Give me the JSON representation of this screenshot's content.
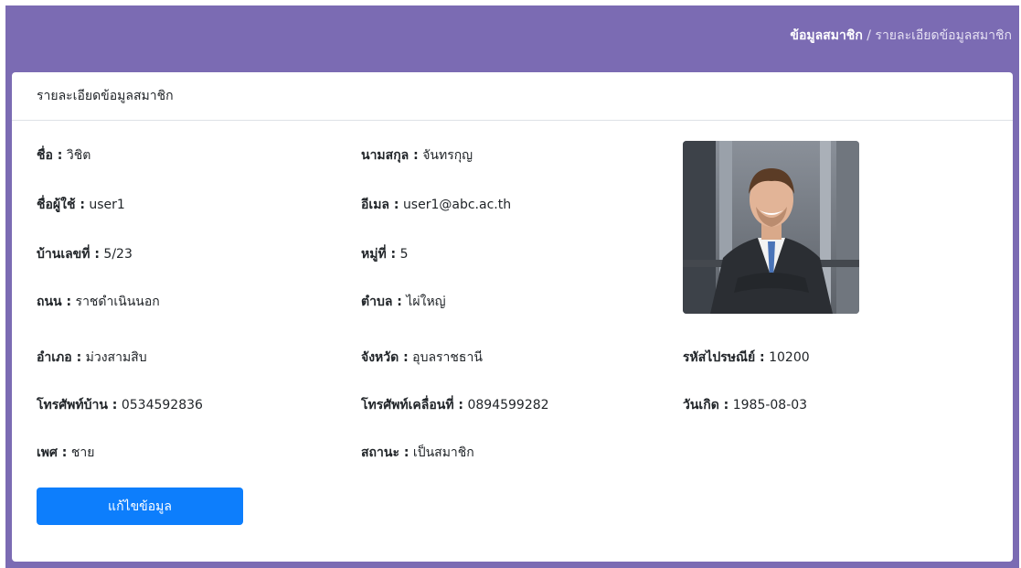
{
  "breadcrumb": {
    "current": "ข้อมูลสมาชิก",
    "separator": "/",
    "item": "รายละเอียดข้อมูลสมาชิก"
  },
  "card": {
    "title": "รายละเอียดข้อมูลสมาชิก"
  },
  "fields": {
    "first_name": {
      "label": "ชื่อ :",
      "value": "วิชิต"
    },
    "last_name": {
      "label": "นามสกุล :",
      "value": "จันทรกุญ"
    },
    "username": {
      "label": "ชื่อผู้ใช้ :",
      "value": "user1"
    },
    "email": {
      "label": "อีเมล :",
      "value": "user1@abc.ac.th"
    },
    "house_no": {
      "label": "บ้านเลขที่ :",
      "value": "5/23"
    },
    "village_no": {
      "label": "หมู่ที่ :",
      "value": "5"
    },
    "road": {
      "label": "ถนน :",
      "value": "ราชดำเนินนอก"
    },
    "subdistrict": {
      "label": "ตำบล :",
      "value": "ไผ่ใหญ่"
    },
    "district": {
      "label": "อำเภอ :",
      "value": "ม่วงสามสิบ"
    },
    "province": {
      "label": "จังหวัด :",
      "value": "อุบลราชธานี"
    },
    "postcode": {
      "label": "รหัสไปรษณีย์ :",
      "value": "10200"
    },
    "home_phone": {
      "label": "โทรศัพท์บ้าน :",
      "value": "0534592836"
    },
    "mobile_phone": {
      "label": "โทรศัพท์เคลื่อนที่ :",
      "value": "0894599282"
    },
    "birthdate": {
      "label": "วันเกิด :",
      "value": "1985-08-03"
    },
    "gender": {
      "label": "เพศ :",
      "value": "ชาย"
    },
    "status": {
      "label": "สถานะ :",
      "value": "เป็นสมาชิก"
    }
  },
  "edit_button": {
    "label": "แก้ไขข้อมูล"
  },
  "colors": {
    "header_bg": "#7b6bb3",
    "button_bg": "#0d7efc"
  }
}
